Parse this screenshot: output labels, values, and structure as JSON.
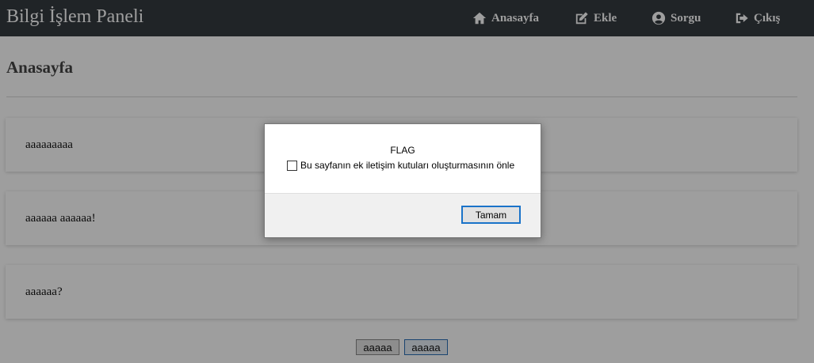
{
  "navbar": {
    "brand": "Bilgi İşlem Paneli",
    "items": [
      {
        "label": "Anasayfa",
        "icon": "home-icon"
      },
      {
        "label": "Ekle",
        "icon": "edit-icon"
      },
      {
        "label": "Sorgu",
        "icon": "user-circle-icon"
      },
      {
        "label": "Çıkış",
        "icon": "sign-out-icon"
      }
    ]
  },
  "main": {
    "title": "Anasayfa",
    "cards": [
      {
        "text": "aaaaaaaaa"
      },
      {
        "text": "aaaaaa aaaaaa!"
      },
      {
        "text": "aaaaaa?"
      }
    ],
    "pagination": [
      "aaaaa",
      "aaaaa"
    ]
  },
  "dialog": {
    "message": "FLAG",
    "checkbox_label": "Bu sayfanın ek iletişim kutuları oluşturmasının önle",
    "checked": false,
    "ok_label": "Tamam"
  },
  "colors": {
    "navbar_bg": "#343a40",
    "ok_border": "#1a73c9"
  }
}
